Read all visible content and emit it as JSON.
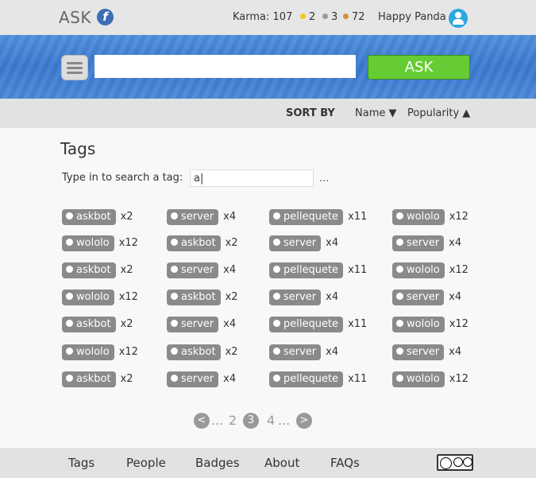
{
  "header": {
    "logo_text": "ASK",
    "karma_label": "Karma: 107",
    "gold_count": "2",
    "silver_count": "3",
    "bronze_count": "72",
    "username": "Happy Panda",
    "colors": {
      "gold": "#f2c81c",
      "silver": "#999999",
      "bronze": "#d4913b",
      "avatar": "#2ea8e0",
      "logo": "#3c6eb4"
    }
  },
  "search": {
    "ask_label": "ASK",
    "value": "",
    "ask_color": "#66cc33"
  },
  "sort": {
    "label": "SORT BY",
    "name_option": "Name",
    "name_arrow": "▼",
    "popularity_option": "Popularity",
    "popularity_arrow": "▲"
  },
  "page": {
    "title": "Tags",
    "search_label": "Type in to search a tag:",
    "search_value": "a|",
    "search_more": "..."
  },
  "tags": [
    [
      {
        "name": "askbot",
        "count": "x2"
      },
      {
        "name": "server",
        "count": "x4"
      },
      {
        "name": "pellequete",
        "count": "x11"
      },
      {
        "name": "wololo",
        "count": "x12"
      }
    ],
    [
      {
        "name": "wololo",
        "count": "x12"
      },
      {
        "name": "askbot",
        "count": "x2"
      },
      {
        "name": "server",
        "count": "x4"
      },
      {
        "name": "server",
        "count": "x4"
      }
    ],
    [
      {
        "name": "askbot",
        "count": "x2"
      },
      {
        "name": "server",
        "count": "x4"
      },
      {
        "name": "pellequete",
        "count": "x11"
      },
      {
        "name": "wololo",
        "count": "x12"
      }
    ],
    [
      {
        "name": "wololo",
        "count": "x12"
      },
      {
        "name": "askbot",
        "count": "x2"
      },
      {
        "name": "server",
        "count": "x4"
      },
      {
        "name": "server",
        "count": "x4"
      }
    ],
    [
      {
        "name": "askbot",
        "count": "x2"
      },
      {
        "name": "server",
        "count": "x4"
      },
      {
        "name": "pellequete",
        "count": "x11"
      },
      {
        "name": "wololo",
        "count": "x12"
      }
    ],
    [
      {
        "name": "wololo",
        "count": "x12"
      },
      {
        "name": "askbot",
        "count": "x2"
      },
      {
        "name": "server",
        "count": "x4"
      },
      {
        "name": "server",
        "count": "x4"
      }
    ],
    [
      {
        "name": "askbot",
        "count": "x2"
      },
      {
        "name": "server",
        "count": "x4"
      },
      {
        "name": "pellequete",
        "count": "x11"
      },
      {
        "name": "wololo",
        "count": "x12"
      }
    ]
  ],
  "pagination": {
    "prev": "<",
    "left_ellipsis": "...",
    "page_2": "2",
    "current": "3",
    "page_4": "4",
    "right_ellipsis": "...",
    "next": ">"
  },
  "footer": {
    "tags": "Tags",
    "people": "People",
    "badges": "Badges",
    "about": "About",
    "faqs": "FAQs",
    "license_icon": "cc-by-icon"
  }
}
